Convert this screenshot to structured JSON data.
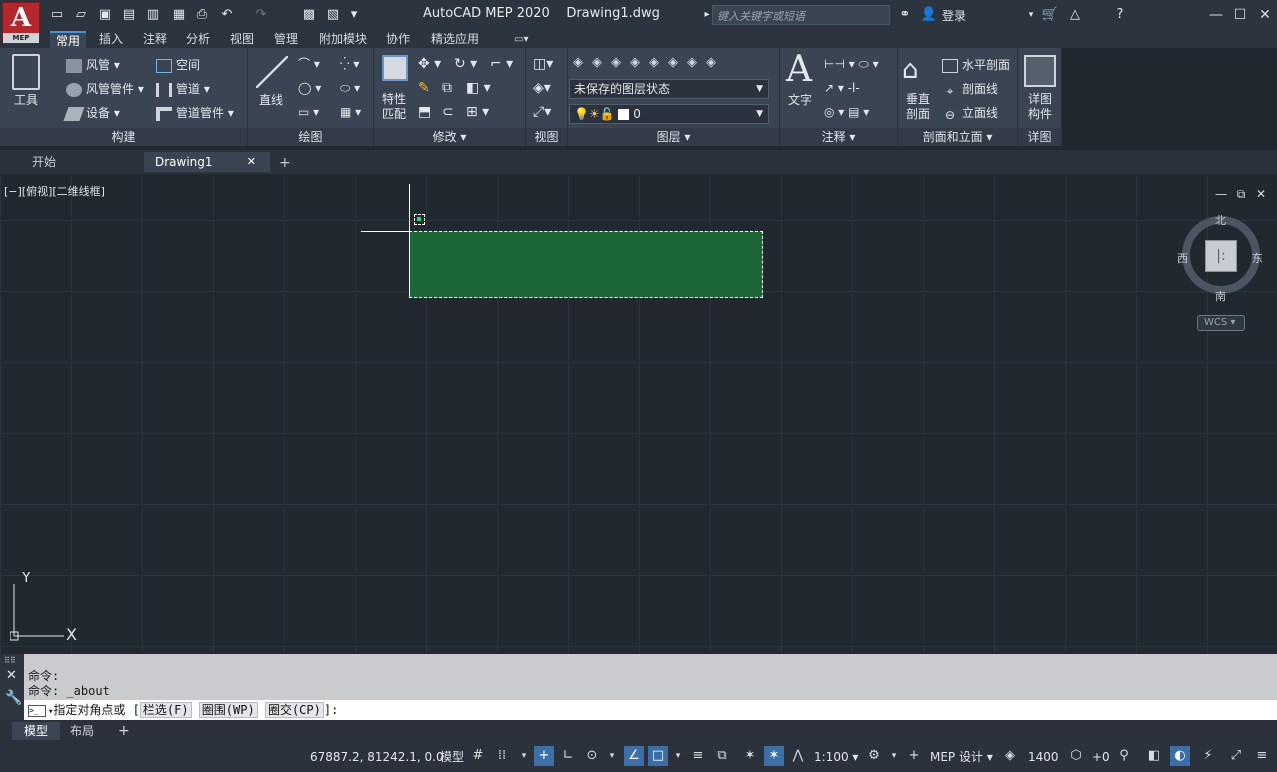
{
  "app": {
    "logo_letter": "A",
    "logo_sub": "MEP",
    "title": "AutoCAD MEP 2020",
    "document": "Drawing1.dwg",
    "search_placeholder": "键入关键字或短语",
    "login": "登录"
  },
  "ribbon_tabs": [
    "常用",
    "插入",
    "注释",
    "分析",
    "视图",
    "管理",
    "附加模块",
    "协作",
    "精选应用"
  ],
  "build_panel": {
    "label": "构建",
    "tools_label": "工具",
    "items": {
      "duct": "风管",
      "space": "空间",
      "duct_fitting": "风管管件",
      "pipe": "管道",
      "equipment": "设备",
      "pipe_fitting": "管道管件"
    }
  },
  "draw_panel": {
    "label": "绘图",
    "line": "直线"
  },
  "modify_panel": {
    "label": "修改",
    "match_props": "特性\n匹配"
  },
  "view_panel": {
    "label": "视图"
  },
  "layer_panel": {
    "label": "图层",
    "state": "未保存的图层状态",
    "current_layer": "0"
  },
  "annotation_panel": {
    "label": "注释",
    "text": "文字"
  },
  "section_panel": {
    "label": "剖面和立面",
    "vertical": "垂直\n剖面",
    "horizontal": "水平剖面",
    "section_line": "剖面线",
    "elevation_line": "立面线"
  },
  "detail_panel": {
    "label": "详图",
    "component": "详图\n构件"
  },
  "file_tabs": [
    {
      "label": "开始"
    },
    {
      "label": "Drawing1"
    }
  ],
  "viewport": {
    "label": "[−][俯视][二维线框]",
    "compass": {
      "north": "北",
      "south": "南",
      "east": "东",
      "west": "西"
    },
    "wcs": "WCS",
    "ucs_x": "X",
    "ucs_y": "Y",
    "selection_color": "#1d6638"
  },
  "command": {
    "history": [
      "命令:",
      "命令: _about"
    ],
    "prompt_prefix": "指定对角点或 [",
    "opt1": "栏选(F)",
    "opt2": "圈围(WP)",
    "opt3": "圈交(CP)",
    "prompt_suffix": "]:"
  },
  "layout_tabs": [
    "模型",
    "布局"
  ],
  "status": {
    "coords": "67887.2, 81242.1, 0.0",
    "model": "模型",
    "scale": "1:100",
    "workspace": "MEP 设计",
    "cut_plane": "1400",
    "plus": "+0"
  }
}
